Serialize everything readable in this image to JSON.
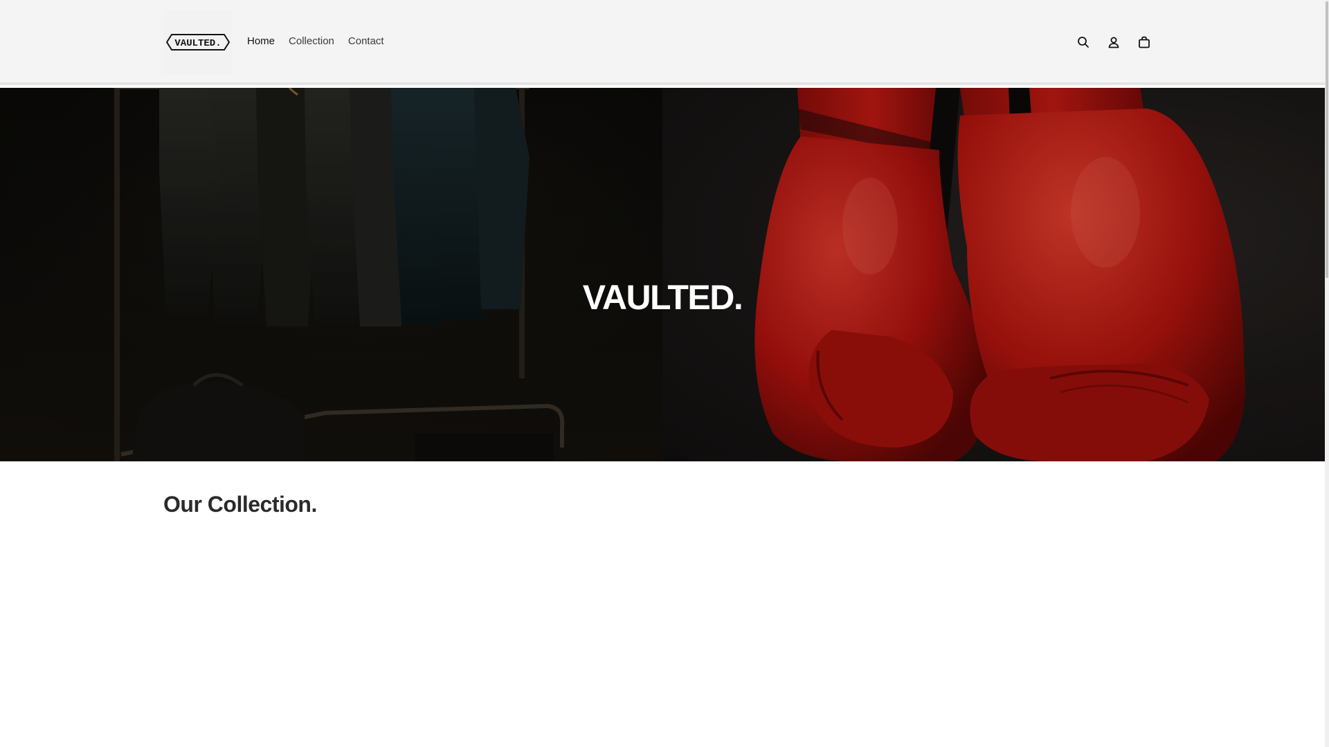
{
  "header": {
    "logo_text": "VAULTED.",
    "nav": [
      {
        "label": "Home"
      },
      {
        "label": "Collection"
      },
      {
        "label": "Contact"
      }
    ],
    "icons": [
      "search-icon",
      "account-icon",
      "cart-icon"
    ]
  },
  "hero": {
    "title": "VAULTED."
  },
  "collection": {
    "title": "Our Collection."
  },
  "colors": {
    "header_bg": "#f4f4f4",
    "hero_text": "#ffffff",
    "glove_red": "#b5130f",
    "heading_text": "#2a2a2a"
  }
}
